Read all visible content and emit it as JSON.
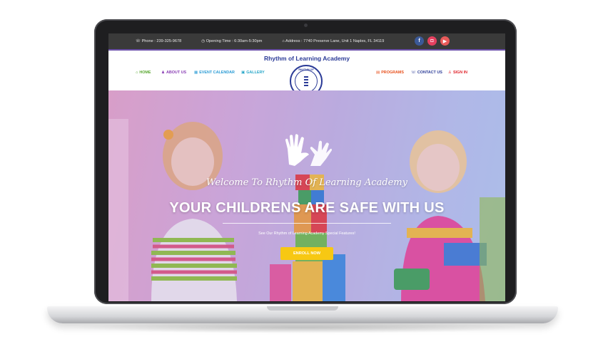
{
  "topbar": {
    "phone": "Phone : 239-325-9678",
    "hours": "Opening Time : 6:30am-5:30pm",
    "address": "Address : 7740 Preserve Lane, Unit 1 Naples, FL 34119",
    "icons": [
      "phone-icon",
      "clock-icon",
      "home-icon"
    ],
    "social": [
      {
        "name": "facebook",
        "glyph": "f",
        "color": "#3b5998"
      },
      {
        "name": "instagram",
        "glyph": "◘",
        "color": "#e4405f"
      },
      {
        "name": "youtube",
        "glyph": "▶",
        "color": "#e85a5a"
      }
    ]
  },
  "site": {
    "title": "Rhythm of Learning Academy",
    "logo_top": "RHYTHM OF",
    "logo_bottom": "LEARNING"
  },
  "nav": {
    "left": [
      {
        "label": "HOME",
        "icon": "home-icon",
        "color": "#5aa832"
      },
      {
        "label": "ABOUT US",
        "icon": "users-icon",
        "color": "#8a3fb5"
      },
      {
        "label": "EVENT CALENDAR",
        "icon": "calendar-icon",
        "color": "#2a9bd5"
      },
      {
        "label": "GALLERY",
        "icon": "image-icon",
        "color": "#2aa7c9"
      }
    ],
    "right": [
      {
        "label": "PROGRAMS",
        "icon": "briefcase-icon",
        "color": "#e8511d"
      },
      {
        "label": "CONTACT US",
        "icon": "phone-icon",
        "color": "#2b3b97"
      },
      {
        "label": "SIGN IN",
        "icon": "user-icon",
        "color": "#e0262d"
      }
    ]
  },
  "hero": {
    "welcome": "Welcome To Rhythm Of Learning Academy",
    "headline": "YOUR CHILDRENS ARE SAFE WITH US",
    "subtitle": "See Our Rhythm of Learning Academy Special Features!",
    "cta": "ENROLL NOW",
    "cta_color": "#f7c813"
  }
}
